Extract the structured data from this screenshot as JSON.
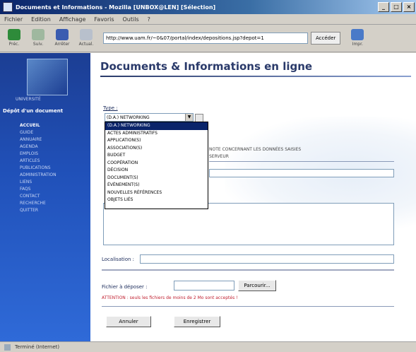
{
  "window": {
    "title": "Documents et Informations - Mozilla [UNBOX@LEN] [Sélection]",
    "controls": [
      "_",
      "□",
      "×"
    ]
  },
  "menubar": {
    "items": [
      "Fichier",
      "Edition",
      "Affichage",
      "Favoris",
      "Outils",
      "?"
    ]
  },
  "toolbar": {
    "back_label": "Préc.",
    "forward_label": "Suiv.",
    "stop_label": "Arrêter",
    "refresh_label": "Actual.",
    "address": "http://www.uam.fr/~0&07/portal/index/depositions.jsp?depot=1",
    "go_label": "Accéder",
    "print_label": "Impr."
  },
  "sidebar": {
    "logo_caption": "UNIVERSITÉ",
    "heading": "Dépôt d'un document",
    "items": [
      "ACCUEIL",
      "GUIDE",
      "ANNUAIRE",
      "AGENDA",
      "EMPLOIS",
      "ARTICLES",
      "PUBLICATIONS",
      "ADMINISTRATION",
      "LIENS",
      "FAQS",
      "CONTACT",
      "RECHERCHE",
      "QUITTER"
    ]
  },
  "page": {
    "title": "Documents & Informations en ligne",
    "type_label": "Type :",
    "type_selected": "(D.A.) NETWORKING",
    "type_options": [
      "(D.A.) NETWORKING",
      "ACTES ADMINISTRATIFS",
      "APPLICATION(S)",
      "ASSOCIATION(S)",
      "BUDGET",
      "COOPÉRATION",
      "DÉCISION",
      "DOCUMENT(S)",
      "ÉVÉNEMENT(S)",
      "NOUVELLES RÉFÉRENCES",
      "OBJETS LIÉS"
    ],
    "right_text_1": "NOTE CONCERNANT LES DONNÉES SAISIES",
    "right_text_2": "SERVEUR",
    "localisation_label": "Localisation :",
    "fichier_label": "Fichier à déposer :",
    "browse_label": "Parcourir...",
    "warning": "ATTENTION : seuls les fichiers de moins de 2 Mo sont acceptés !",
    "annuler_label": "Annuler",
    "enregistrer_label": "Enregistrer"
  },
  "statusbar": {
    "text": "Terminé (Internet)"
  }
}
